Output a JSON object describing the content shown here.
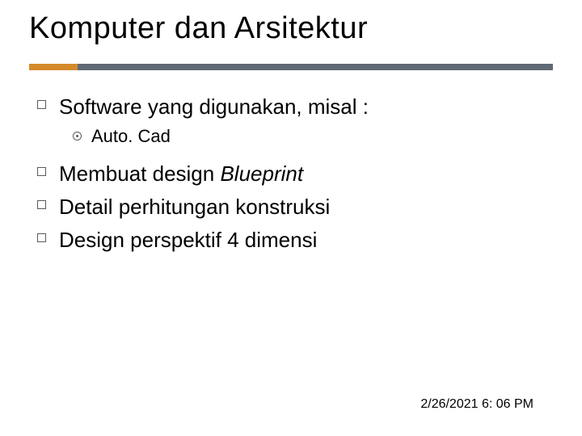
{
  "title": "Komputer dan Arsitektur",
  "items": {
    "0": {
      "text": "Software yang digunakan, misal :"
    },
    "1": {
      "text_pre": "Membuat design ",
      "text_em": "Blueprint"
    },
    "2": {
      "text": "Detail perhitungan konstruksi"
    },
    "3": {
      "text": "Design perspektif 4 dimensi"
    }
  },
  "subitems": {
    "0": {
      "text": "Auto. Cad"
    }
  },
  "footer": "2/26/2021 6: 06 PM"
}
